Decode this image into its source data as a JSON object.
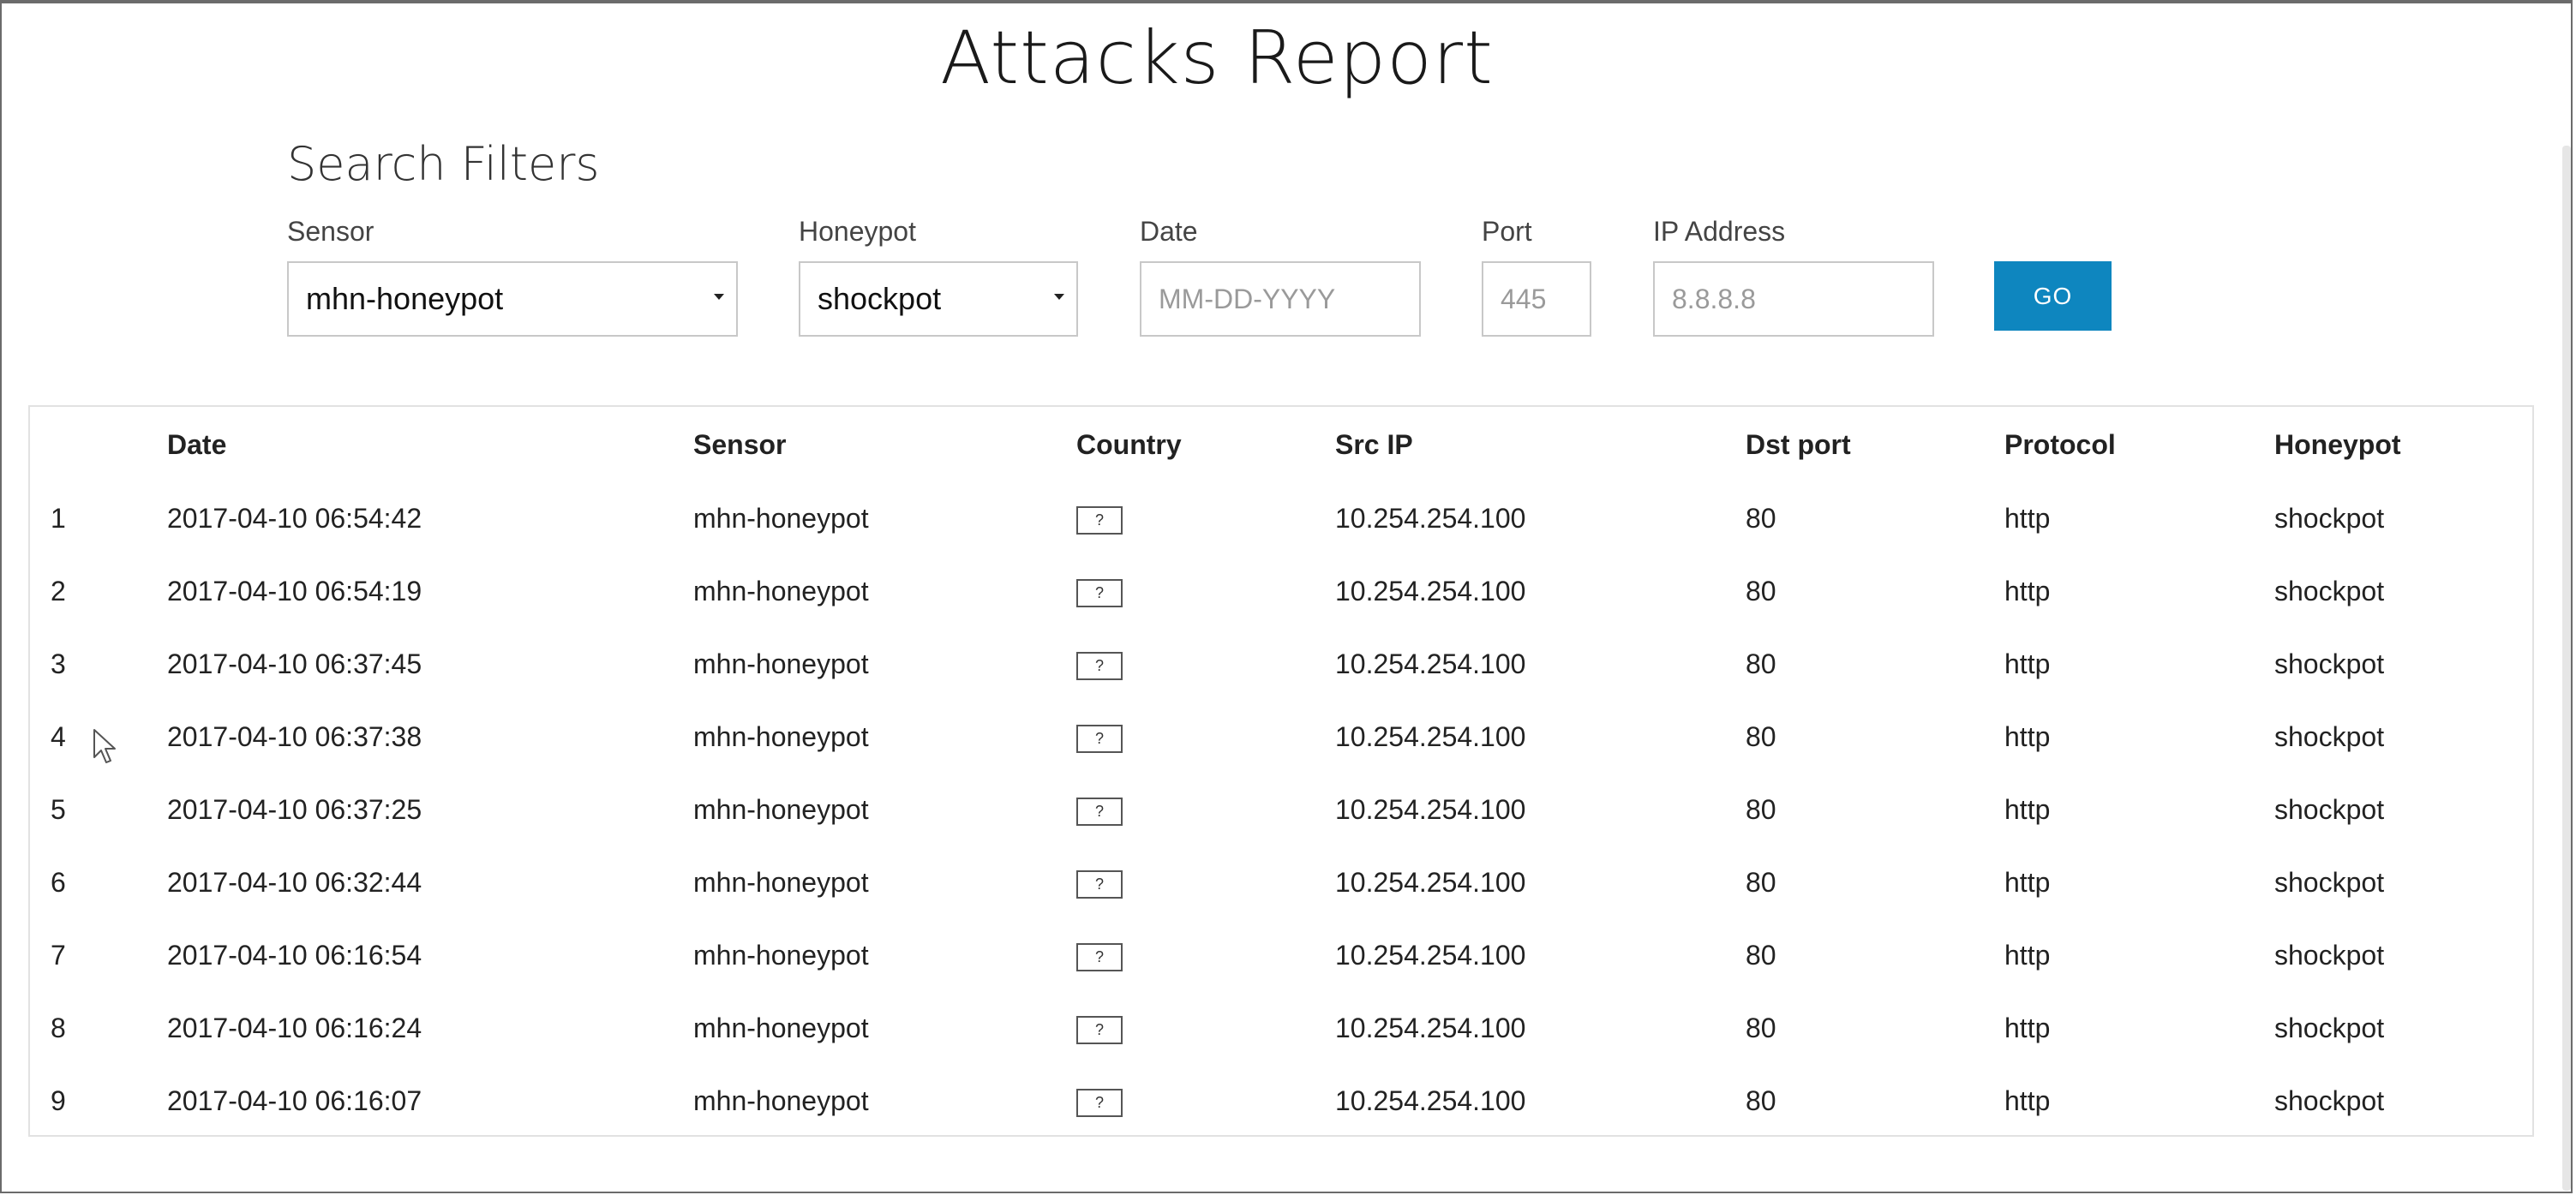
{
  "page": {
    "title": "Attacks Report"
  },
  "filters": {
    "title": "Search Filters",
    "sensor": {
      "label": "Sensor",
      "value": "mhn-honeypot"
    },
    "honeypot": {
      "label": "Honeypot",
      "value": "shockpot"
    },
    "date": {
      "label": "Date",
      "placeholder": "MM-DD-YYYY"
    },
    "port": {
      "label": "Port",
      "placeholder": "445"
    },
    "ip": {
      "label": "IP Address",
      "placeholder": "8.8.8.8"
    },
    "go_label": "GO",
    "accent_color": "#0e86bf"
  },
  "table": {
    "columns": [
      "",
      "Date",
      "Sensor",
      "Country",
      "Src IP",
      "Dst port",
      "Protocol",
      "Honeypot"
    ],
    "flag_icon": "unknown-flag-icon",
    "flag_text": "?",
    "rows": [
      {
        "num": "1",
        "date": "2017-04-10 06:54:42",
        "sensor": "mhn-honeypot",
        "src": "10.254.254.100",
        "port": "80",
        "protocol": "http",
        "honeypot": "shockpot"
      },
      {
        "num": "2",
        "date": "2017-04-10 06:54:19",
        "sensor": "mhn-honeypot",
        "src": "10.254.254.100",
        "port": "80",
        "protocol": "http",
        "honeypot": "shockpot"
      },
      {
        "num": "3",
        "date": "2017-04-10 06:37:45",
        "sensor": "mhn-honeypot",
        "src": "10.254.254.100",
        "port": "80",
        "protocol": "http",
        "honeypot": "shockpot"
      },
      {
        "num": "4",
        "date": "2017-04-10 06:37:38",
        "sensor": "mhn-honeypot",
        "src": "10.254.254.100",
        "port": "80",
        "protocol": "http",
        "honeypot": "shockpot"
      },
      {
        "num": "5",
        "date": "2017-04-10 06:37:25",
        "sensor": "mhn-honeypot",
        "src": "10.254.254.100",
        "port": "80",
        "protocol": "http",
        "honeypot": "shockpot"
      },
      {
        "num": "6",
        "date": "2017-04-10 06:32:44",
        "sensor": "mhn-honeypot",
        "src": "10.254.254.100",
        "port": "80",
        "protocol": "http",
        "honeypot": "shockpot"
      },
      {
        "num": "7",
        "date": "2017-04-10 06:16:54",
        "sensor": "mhn-honeypot",
        "src": "10.254.254.100",
        "port": "80",
        "protocol": "http",
        "honeypot": "shockpot"
      },
      {
        "num": "8",
        "date": "2017-04-10 06:16:24",
        "sensor": "mhn-honeypot",
        "src": "10.254.254.100",
        "port": "80",
        "protocol": "http",
        "honeypot": "shockpot"
      },
      {
        "num": "9",
        "date": "2017-04-10 06:16:07",
        "sensor": "mhn-honeypot",
        "src": "10.254.254.100",
        "port": "80",
        "protocol": "http",
        "honeypot": "shockpot"
      }
    ]
  }
}
